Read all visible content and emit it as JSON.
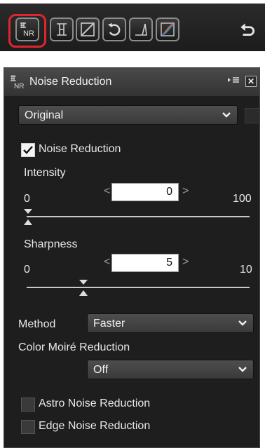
{
  "toolbar": {
    "tools": [
      {
        "name": "noise-reduction-tool",
        "label": "NR",
        "selected": true
      },
      {
        "name": "perspective-tool"
      },
      {
        "name": "levels-curves-tool"
      },
      {
        "name": "rotate-tool"
      },
      {
        "name": "straighten-tool"
      },
      {
        "name": "color-curve-tool"
      }
    ],
    "undo_icon": "undo-icon"
  },
  "panel": {
    "title": "Noise Reduction",
    "icon_label": "NR",
    "preset": {
      "value": "Original"
    },
    "noise_reduction": {
      "label": "Noise Reduction",
      "checked": true
    },
    "intensity": {
      "label": "Intensity",
      "min": "0",
      "max": "100",
      "value": "0",
      "level": 0
    },
    "sharpness": {
      "label": "Sharpness",
      "min": "0",
      "max": "10",
      "value": "5",
      "level": 5
    },
    "method": {
      "label": "Method",
      "value": "Faster"
    },
    "color_moire": {
      "label": "Color Moiré Reduction",
      "value": "Off"
    },
    "astro": {
      "label": "Astro Noise Reduction",
      "checked": false
    },
    "edge": {
      "label": "Edge Noise Reduction",
      "checked": false
    }
  },
  "colors": {
    "highlight": "#e0252e",
    "panel_bg": "#1e1e1e"
  }
}
